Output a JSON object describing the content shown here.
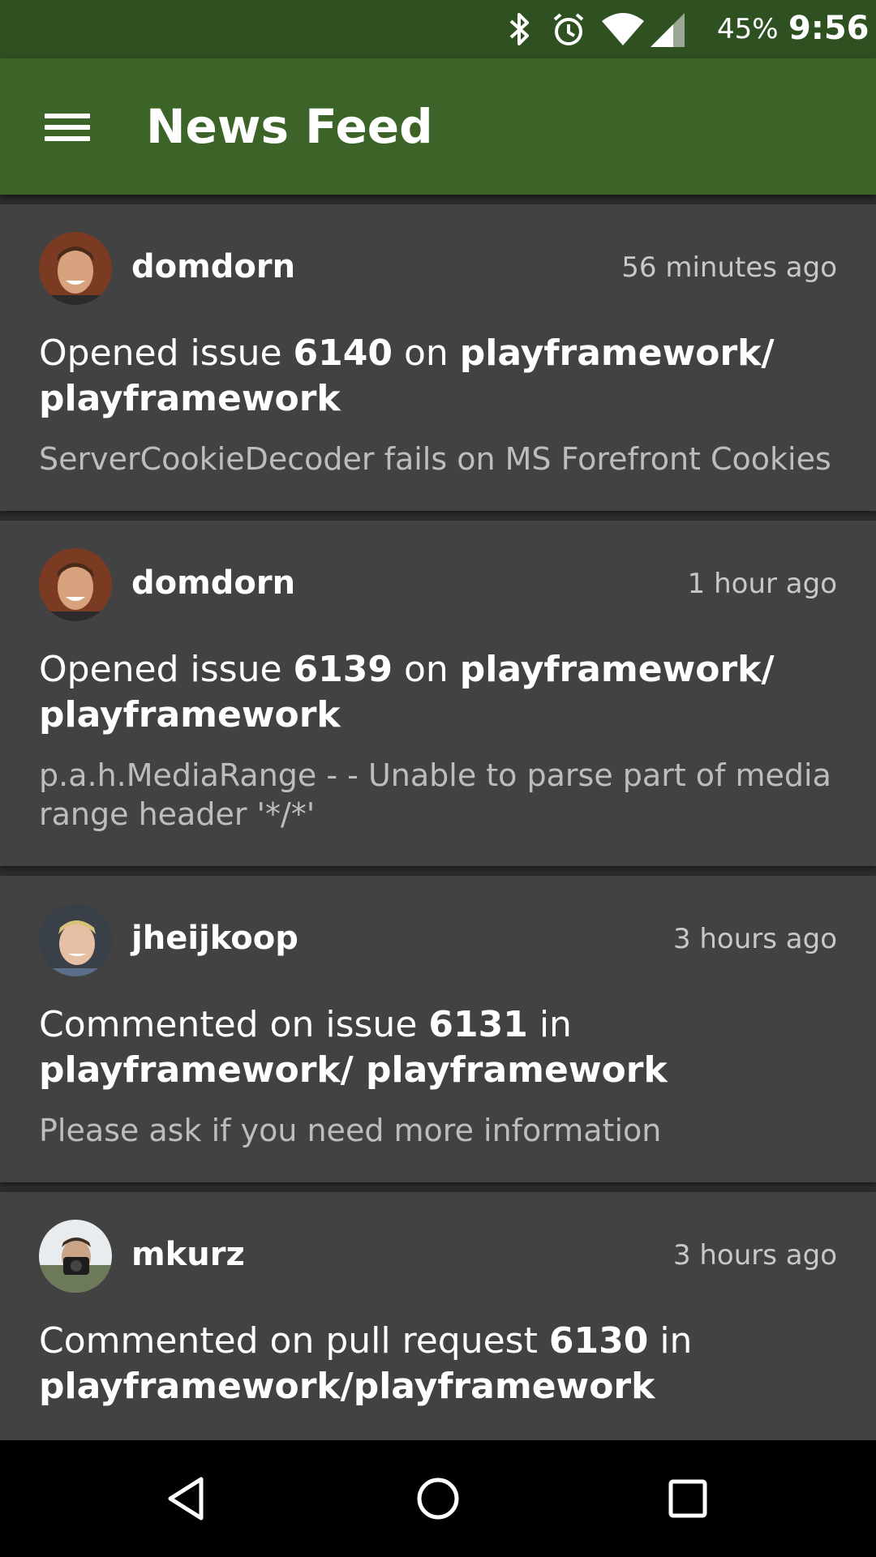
{
  "status_bar": {
    "battery": "45%",
    "time": "9:56",
    "icons": [
      "bluetooth-icon",
      "alarm-icon",
      "wifi-icon",
      "cell-signal-icon"
    ],
    "background": "#2f5121"
  },
  "app_bar": {
    "title": "News Feed",
    "menu_icon": "hamburger-menu-icon",
    "background": "#3c6428"
  },
  "feed": [
    {
      "user": "domdorn",
      "time": "56 minutes ago",
      "verb": "Opened issue ",
      "number": "6140",
      "prep": " on ",
      "repo": "playframework/ playframework",
      "detail": "ServerCookieDecoder fails on MS Forefront Cookies"
    },
    {
      "user": "domdorn",
      "time": "1 hour ago",
      "verb": "Opened issue ",
      "number": "6139",
      "prep": " on ",
      "repo": "playframework/ playframework",
      "detail": "p.a.h.MediaRange -  - Unable to parse part of media range header '*/*'"
    },
    {
      "user": "jheijkoop",
      "time": "3 hours ago",
      "verb": "Commented on issue ",
      "number": "6131",
      "prep": " in ",
      "repo": "playframework/ playframework",
      "detail": "Please ask if you need more information"
    },
    {
      "user": "mkurz",
      "time": "3 hours ago",
      "verb": "Commented on pull request ",
      "number": "6130",
      "prep": " in ",
      "repo": "playframework/playframework",
      "detail": ""
    }
  ],
  "nav_bar": {
    "icons": [
      "back-icon",
      "home-icon",
      "recents-icon"
    ]
  },
  "colors": {
    "card": "#424242",
    "background": "#2d2d2d",
    "secondary_text": "#bdbdbd"
  }
}
